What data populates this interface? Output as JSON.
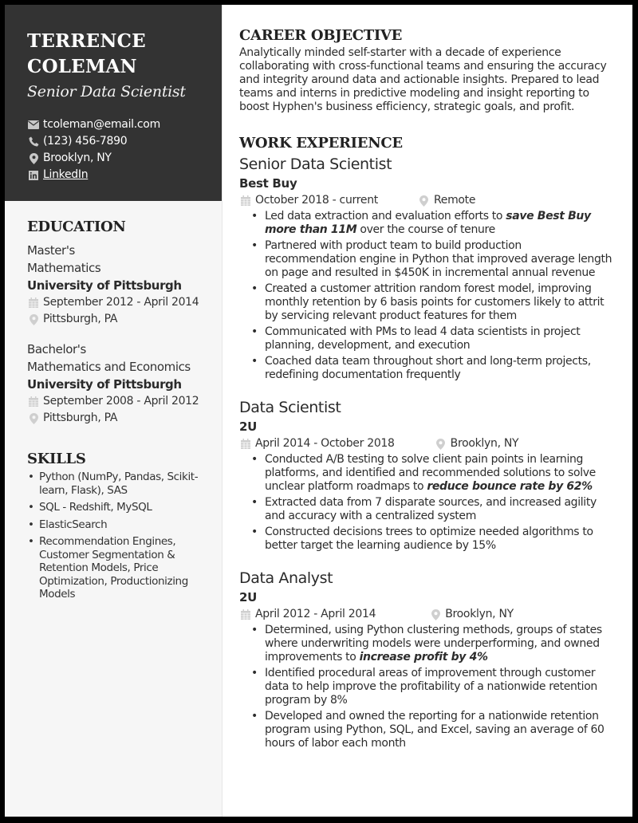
{
  "header": {
    "name_line1": "TERRENCE",
    "name_line2": "COLEMAN",
    "title": "Senior Data Scientist",
    "contacts": {
      "email": {
        "icon": "envelope-icon",
        "text": "tcoleman@email.com"
      },
      "phone": {
        "icon": "phone-icon",
        "text": "(123) 456-7890"
      },
      "location": {
        "icon": "map-pin-icon",
        "text": "Brooklyn, NY"
      },
      "linkedin": {
        "icon": "linkedin-icon",
        "text": "LinkedIn"
      }
    }
  },
  "education": {
    "heading": "EDUCATION",
    "items": [
      {
        "degree": "Master's",
        "field": "Mathematics",
        "school": "University of Pittsburgh",
        "dates": "September 2012 - April 2014",
        "location": "Pittsburgh, PA"
      },
      {
        "degree": "Bachelor's",
        "field": "Mathematics and Economics",
        "school": "University of Pittsburgh",
        "dates": "September 2008 - April 2012",
        "location": "Pittsburgh, PA"
      }
    ]
  },
  "skills": {
    "heading": "SKILLS",
    "items": [
      "Python (NumPy, Pandas, Scikit-learn, Flask), SAS",
      "SQL - Redshift, MySQL",
      "ElasticSearch",
      "Recommendation Engines, Customer Segmentation & Retention Models, Price Optimization, Productionizing Models"
    ]
  },
  "objective": {
    "heading": "CAREER OBJECTIVE",
    "text": "Analytically minded self-starter with a decade of experience collaborating with cross-functional teams and ensuring the accuracy and integrity around data and actionable insights. Prepared to lead teams and interns in predictive modeling and insight reporting to boost Hyphen's business efficiency, strategic goals, and profit."
  },
  "work": {
    "heading": "WORK EXPERIENCE",
    "jobs": [
      {
        "title": "Senior Data Scientist",
        "company": "Best Buy",
        "dates": "October 2018 - current",
        "location": "Remote",
        "bullets": [
          {
            "pre": "Led data extraction and evaluation efforts to ",
            "em": "save Best Buy more than 11M",
            "post": " over the course of tenure"
          },
          {
            "pre": "Partnered with product team to build production recommendation engine in Python that improved average length on page and resulted in $450K in incremental annual revenue",
            "em": "",
            "post": ""
          },
          {
            "pre": "Created a customer attrition random forest model, improving monthly retention by 6 basis points for customers likely to attrit by servicing relevant product features for them",
            "em": "",
            "post": ""
          },
          {
            "pre": "Communicated with PMs to lead 4 data scientists in project planning, development, and execution",
            "em": "",
            "post": ""
          },
          {
            "pre": "Coached data team throughout short and long-term projects, redefining documentation frequently",
            "em": "",
            "post": ""
          }
        ]
      },
      {
        "title": "Data Scientist",
        "company": "2U",
        "dates": "April 2014 - October 2018",
        "location": "Brooklyn, NY",
        "bullets": [
          {
            "pre": "Conducted A/B testing to solve client pain points in learning platforms, and identified and recommended solutions to solve unclear platform roadmaps to ",
            "em": "reduce bounce rate by 62%",
            "post": ""
          },
          {
            "pre": "Extracted data from 7 disparate sources, and increased agility and accuracy with a centralized system",
            "em": "",
            "post": ""
          },
          {
            "pre": "Constructed decisions trees to optimize needed algorithms to better target the learning audience by 15%",
            "em": "",
            "post": ""
          }
        ]
      },
      {
        "title": "Data Analyst",
        "company": "2U",
        "dates": "April 2012 - April 2014",
        "location": "Brooklyn, NY",
        "bullets": [
          {
            "pre": "Determined, using Python clustering methods, groups of states where underwriting models were underperforming, and owned improvements to ",
            "em": "increase profit by 4%",
            "post": ""
          },
          {
            "pre": "Identified procedural areas of improvement through customer data to help improve the profitability of a nationwide retention program by 8%",
            "em": "",
            "post": ""
          },
          {
            "pre": "Developed and owned the reporting for a nationwide retention program using Python, SQL, and Excel, saving an average of 60 hours of labor each month",
            "em": "",
            "post": ""
          }
        ]
      }
    ]
  },
  "colors": {
    "header_bg": "#333333",
    "sidebar_bg": "#f6f6f6",
    "icon_gray": "#c4c4c4",
    "text": "#2b2b2b"
  }
}
